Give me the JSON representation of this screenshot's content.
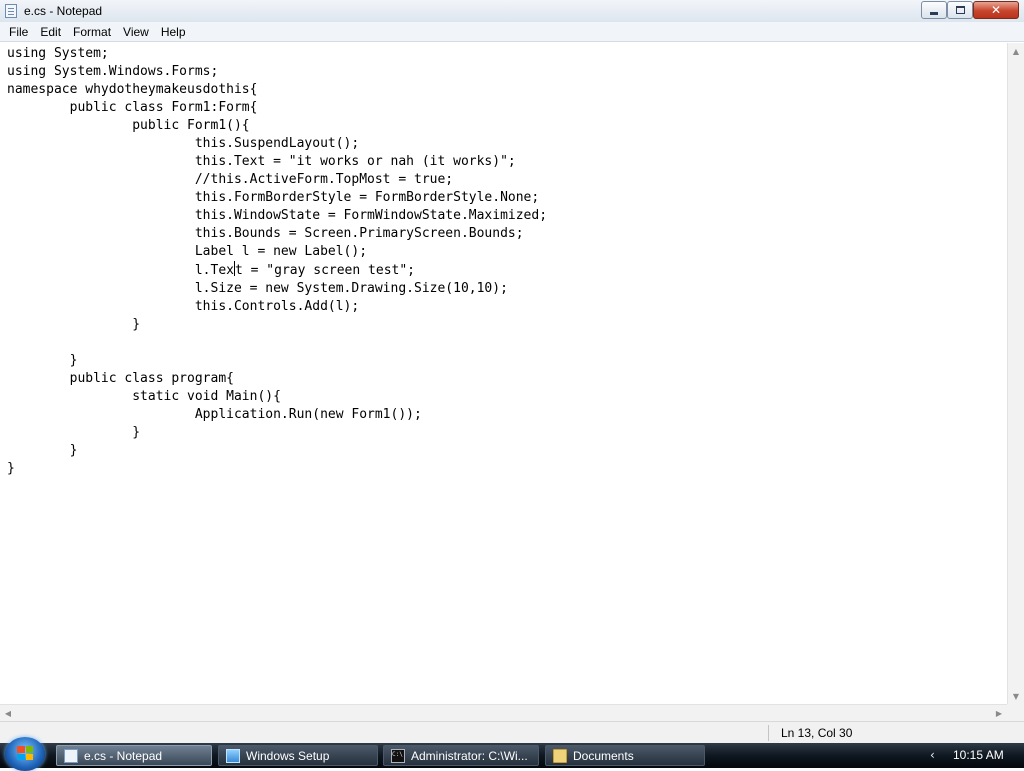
{
  "window": {
    "title": "e.cs - Notepad",
    "controls": {
      "minimize": "minimize",
      "maximize": "restore",
      "close": "✕"
    }
  },
  "menu": {
    "items": [
      "File",
      "Edit",
      "Format",
      "View",
      "Help"
    ]
  },
  "editor": {
    "lines": [
      "using System;",
      "using System.Windows.Forms;",
      "namespace whydotheymakeusdothis{",
      "        public class Form1:Form{",
      "                public Form1(){",
      "                        this.SuspendLayout();",
      "                        this.Text = \"it works or nah (it works)\";",
      "                        //this.ActiveForm.TopMost = true;",
      "                        this.FormBorderStyle = FormBorderStyle.None;",
      "                        this.WindowState = FormWindowState.Maximized;",
      "                        this.Bounds = Screen.PrimaryScreen.Bounds;",
      "                        Label l = new Label();",
      "                        l.Text = \"gray screen test\";",
      "                        l.Size = new System.Drawing.Size(10,10);",
      "                        this.Controls.Add(l);",
      "                }",
      "",
      "        }",
      "        public class program{",
      "                static void Main(){",
      "                        Application.Run(new Form1());",
      "                }",
      "        }",
      "}"
    ],
    "caret": {
      "line": 13,
      "col": 30
    }
  },
  "statusbar": {
    "position": "Ln 13, Col 30"
  },
  "taskbar": {
    "buttons": [
      {
        "label": "e.cs - Notepad",
        "icon": "notepad-icon",
        "active": true
      },
      {
        "label": "Windows Setup",
        "icon": "setup-icon",
        "active": false
      },
      {
        "label": "Administrator: C:\\Wi...",
        "icon": "cmd-icon",
        "active": false
      },
      {
        "label": "Documents",
        "icon": "folder-icon",
        "active": false
      }
    ],
    "tray_chevron": "‹",
    "clock": "10:15 AM"
  },
  "colors": {
    "taskbar": "#0f1720",
    "close_button": "#c8462d",
    "start_orb": "#1d62b7"
  }
}
